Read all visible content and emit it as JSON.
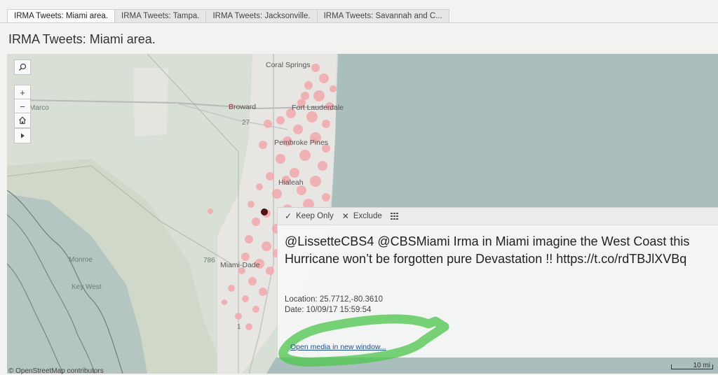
{
  "tabs": [
    {
      "label": "IRMA Tweets: Miami area.",
      "active": true
    },
    {
      "label": "IRMA Tweets: Tampa.",
      "active": false
    },
    {
      "label": "IRMA Tweets: Jacksonville.",
      "active": false
    },
    {
      "label": "IRMA Tweets: Savannah and C...",
      "active": false
    }
  ],
  "title": "IRMA Tweets: Miami area.",
  "map": {
    "labels": {
      "coral_springs": "Coral Springs",
      "broward": "Broward",
      "fort_lauderdale": "Fort Lauderdale",
      "pembroke_pines": "Pembroke Pines",
      "hialeah": "Hialeah",
      "miami_dade": "Miami-Dade",
      "monroe": "Monroe",
      "key_west": "Key West",
      "marco": "Marco",
      "road_786": "786",
      "road_27": "27",
      "road_1": "1"
    },
    "attribution": "© OpenStreetMap contributors",
    "scale_label": "10 mi",
    "colors": {
      "water": "#aabebd",
      "land": "#d8dfd4",
      "urban": "#e8e6e3",
      "points": "#f2a8ac",
      "selected": "#5a1010",
      "highlight": "#4cc64c"
    }
  },
  "toolbar": {
    "search_icon": "magnifier",
    "zoom_in": "+",
    "zoom_out": "−",
    "home_icon": "home",
    "play_icon": "play-triangle"
  },
  "tooltip": {
    "keep_only": "Keep Only",
    "exclude": "Exclude",
    "tweet_text": "@LissetteCBS4 @CBSMiami Irma in Miami imagine the West Coast this Hurricane won’t be forgotten pure Devastation !! https://t.co/rdTBJlXVBq",
    "location": "Location: 25.7712,-80.3610",
    "date": "Date: 10/09/17 15:59:54",
    "open_media": "Open media in new window..."
  }
}
